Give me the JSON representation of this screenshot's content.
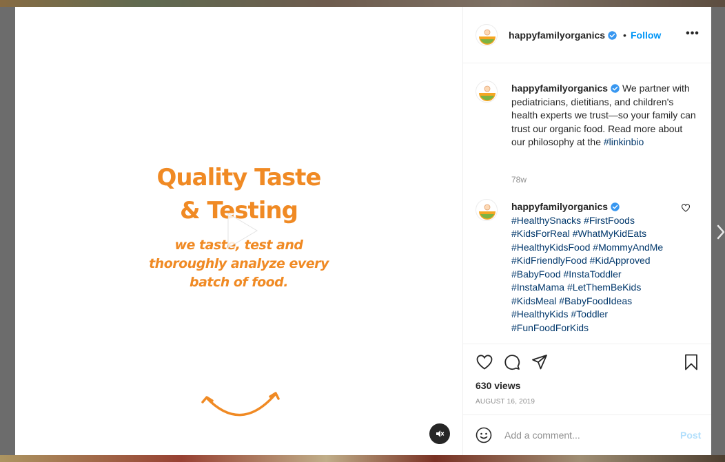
{
  "post": {
    "username": "happyfamilyorganics",
    "follow_label": "Follow",
    "dot": "•",
    "more_label": "•••"
  },
  "media": {
    "headline_line1": "Quality Taste",
    "headline_line2": "& Testing",
    "subline_line1": "we taste, test and",
    "subline_line2": "thoroughly analyze every",
    "subline_line3": "batch of food.",
    "accent_color": "#f08a24"
  },
  "caption": {
    "username": "happyfamilyorganics",
    "text": "We partner with pediatricians, dietitians, and children's health experts we trust—so your family can trust our organic food. Read more about our philosophy at the",
    "hashtag": "#linkinbio",
    "time": "78w"
  },
  "comment": {
    "username": "happyfamilyorganics",
    "hashtags": [
      "#HealthySnacks",
      "#FirstFoods",
      "#KidsForReal",
      "#WhatMyKidEats",
      "#HealthyKidsFood",
      "#MommyAndMe",
      "#KidFriendlyFood",
      "#KidApproved",
      "#BabyFood",
      "#InstaToddler",
      "#InstaMama",
      "#LetThemBeKids",
      "#KidsMeal",
      "#BabyFoodIdeas",
      "#HealthyKids",
      "#Toddler",
      "#FunFoodForKids"
    ]
  },
  "stats": {
    "views": "630 views",
    "date": "AUGUST 16, 2019"
  },
  "composer": {
    "placeholder": "Add a comment...",
    "post_label": "Post"
  },
  "icons": {
    "verified": "verified-badge-icon",
    "like": "heart-icon",
    "comment": "comment-bubble-icon",
    "share": "paper-plane-icon",
    "save": "bookmark-icon",
    "emoji": "emoji-icon",
    "mute": "speaker-muted-icon",
    "play": "play-icon"
  },
  "colors": {
    "link": "#0095f6",
    "hashtag": "#00376b",
    "post_disabled": "#b2dffc",
    "verified": "#3897f0"
  }
}
